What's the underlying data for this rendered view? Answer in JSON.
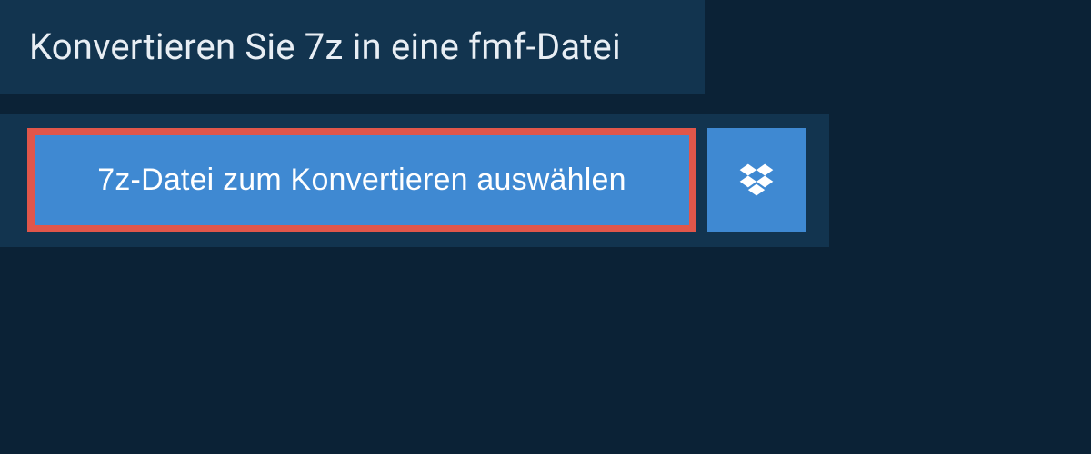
{
  "header": {
    "title": "Konvertieren Sie 7z in eine fmf-Datei"
  },
  "uploader": {
    "select_file_label": "7z-Datei zum Konvertieren auswählen",
    "dropbox_icon": "dropbox-icon"
  },
  "colors": {
    "page_bg": "#0b2236",
    "panel_bg": "#12344f",
    "button_bg": "#3f89d2",
    "highlight_border": "#e0564a",
    "text_light": "#e8eef4",
    "text_on_button": "#ffffff"
  }
}
